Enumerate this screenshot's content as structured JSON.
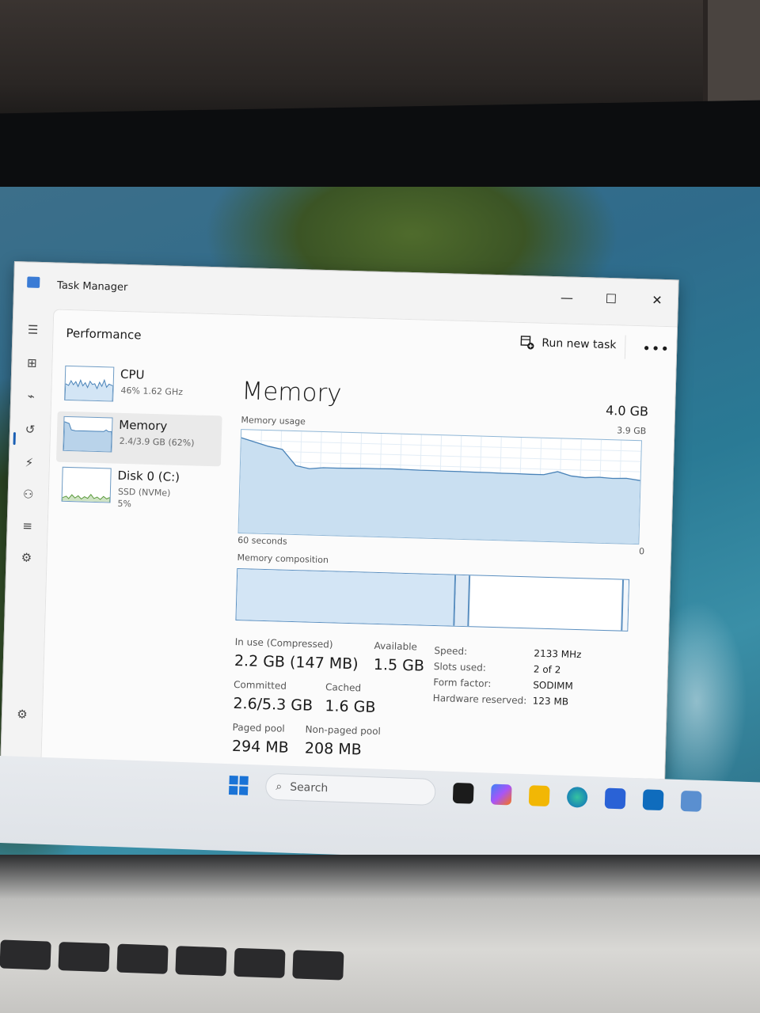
{
  "window": {
    "app_title": "Task Manager",
    "controls": {
      "minimize": "—",
      "maximize": "☐",
      "close": "✕"
    }
  },
  "nav": {
    "icons": [
      "hamburger-icon",
      "processes-icon",
      "performance-icon",
      "app-history-icon",
      "startup-icon",
      "users-icon",
      "details-icon",
      "services-icon",
      "settings-icon"
    ]
  },
  "header": {
    "page_title": "Performance",
    "run_new_task": "Run new task",
    "more": "•••"
  },
  "devices": [
    {
      "name": "CPU",
      "sub": "46%  1.62 GHz",
      "sub2": ""
    },
    {
      "name": "Memory",
      "sub": "2.4/3.9 GB (62%)",
      "sub2": ""
    },
    {
      "name": "Disk 0 (C:)",
      "sub": "SSD (NVMe)",
      "sub2": "5%"
    }
  ],
  "memory": {
    "title": "Memory",
    "total": "4.0 GB",
    "usage_label": "Memory usage",
    "usage_max": "3.9 GB",
    "time_label": "60 seconds",
    "zero_label": "0",
    "composition_label": "Memory composition",
    "in_use_label": "In use (Compressed)",
    "in_use_value": "2.2 GB (147 MB)",
    "available_label": "Available",
    "available_value": "1.5 GB",
    "committed_label": "Committed",
    "committed_value": "2.6/5.3 GB",
    "cached_label": "Cached",
    "cached_value": "1.6 GB",
    "paged_label": "Paged pool",
    "paged_value": "294 MB",
    "nonpaged_label": "Non-paged pool",
    "nonpaged_value": "208 MB",
    "specs": [
      {
        "label": "Speed:",
        "value": "2133 MHz"
      },
      {
        "label": "Slots used:",
        "value": "2 of 2"
      },
      {
        "label": "Form factor:",
        "value": "SODIMM"
      },
      {
        "label": "Hardware reserved:",
        "value": "123 MB"
      }
    ]
  },
  "chart_data": {
    "type": "area",
    "title": "Memory usage",
    "xlabel": "60 seconds",
    "ylabel": "",
    "ylim": [
      0,
      3.9
    ],
    "y_unit": "GB",
    "values": [
      3.6,
      3.45,
      3.3,
      3.2,
      2.6,
      2.5,
      2.55,
      2.55,
      2.56,
      2.57,
      2.57,
      2.58,
      2.57,
      2.56,
      2.56,
      2.55,
      2.55,
      2.54,
      2.54,
      2.53,
      2.53,
      2.52,
      2.52,
      2.65,
      2.5,
      2.45,
      2.48,
      2.45,
      2.47,
      2.4
    ]
  },
  "composition": {
    "in_use_gb": 2.2,
    "modified_gb": 0.1,
    "standby_gb": 1.5,
    "total_gb": 3.9
  },
  "taskbar": {
    "search_placeholder": "Search",
    "apps": [
      "terminal-icon",
      "copilot-icon",
      "file-explorer-icon",
      "edge-icon",
      "store-icon",
      "outlook-icon",
      "task-manager-icon"
    ]
  }
}
